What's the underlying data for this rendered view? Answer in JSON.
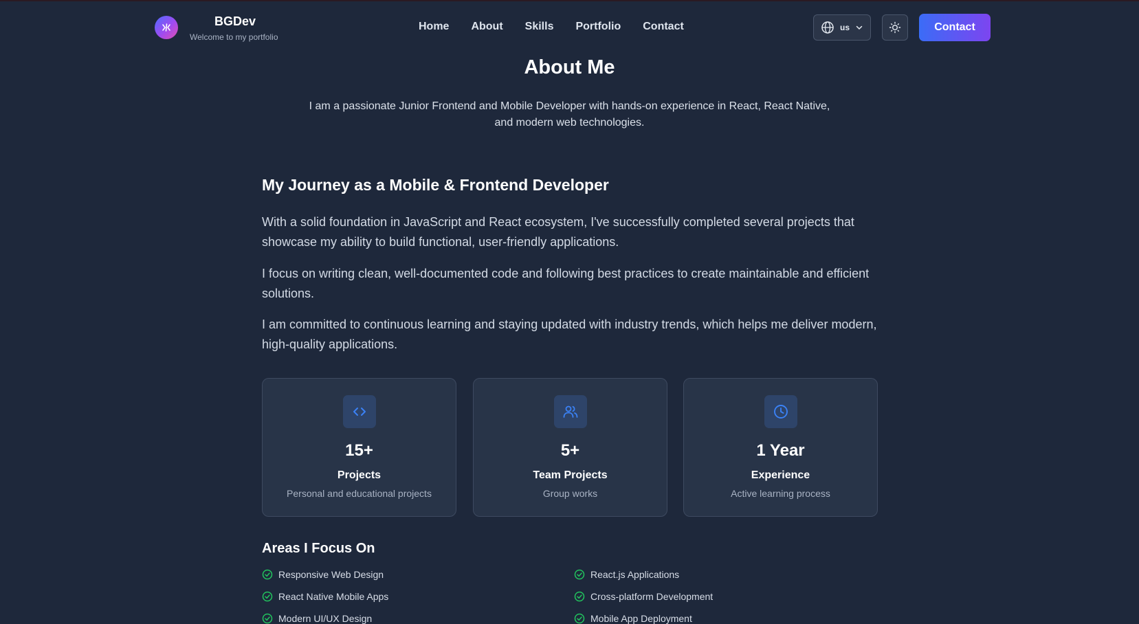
{
  "header": {
    "brand_name": "BGDev",
    "brand_subtitle": "Welcome to my portfolio",
    "nav": [
      "Home",
      "About",
      "Skills",
      "Portfolio",
      "Contact"
    ],
    "language_code": "us",
    "contact_label": "Contact"
  },
  "about": {
    "title": "About Me",
    "intro": "I am a passionate Junior Frontend and Mobile Developer with hands-on experience in React, React Native, and modern web technologies.",
    "journey_title": "My Journey as a Mobile & Frontend Developer",
    "paragraphs": [
      "With a solid foundation in JavaScript and React ecosystem, I've successfully completed several projects that showcase my ability to build functional, user-friendly applications.",
      "I focus on writing clean, well-documented code and following best practices to create maintainable and efficient solutions.",
      "I am committed to continuous learning and staying updated with industry trends, which helps me deliver modern, high-quality applications."
    ],
    "stats": [
      {
        "icon": "code-icon",
        "value": "15+",
        "label": "Projects",
        "desc": "Personal and educational projects"
      },
      {
        "icon": "users-icon",
        "value": "5+",
        "label": "Team Projects",
        "desc": "Group works"
      },
      {
        "icon": "clock-icon",
        "value": "1 Year",
        "label": "Experience",
        "desc": "Active learning process"
      }
    ],
    "focus_title": "Areas I Focus On",
    "focus_items": [
      "Responsive Web Design",
      "React.js Applications",
      "React Native Mobile Apps",
      "Cross-platform Development",
      "Modern UI/UX Design",
      "Mobile App Deployment"
    ]
  },
  "colors": {
    "background": "#1e283b",
    "card": "#283448",
    "accent_blue": "#3b82f6",
    "accent_purple": "#7d45f0",
    "check_green": "#22c55e"
  }
}
